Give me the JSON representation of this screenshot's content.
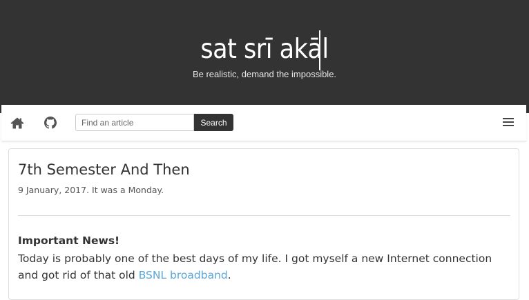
{
  "header": {
    "title": "sat srī akāl",
    "tagline": "Be realistic, demand the impossible."
  },
  "nav": {
    "home_icon": "home-icon",
    "github_icon": "github-icon",
    "search": {
      "placeholder": "Find an article",
      "button_label": "Search"
    },
    "menu_icon": "hamburger-menu-icon"
  },
  "post": {
    "title": "7th Semester And Then",
    "date": "9 January, 2017. It was a Monday.",
    "heading": "Important News!",
    "body_before": "Today is probably one of the best days of my life. I got myself a new Internet connection and got rid of that old ",
    "link_text": "BSNL broadband",
    "body_after": "."
  },
  "colors": {
    "header_bg": "#333333",
    "link": "#5aa6d8",
    "text": "#333333"
  }
}
